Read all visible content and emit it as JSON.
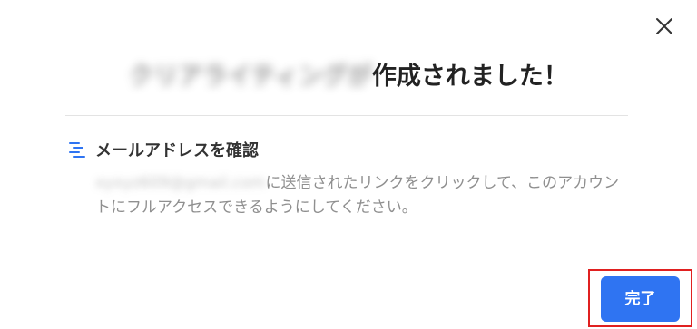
{
  "dialog": {
    "title_blurred_prefix": "クリアライティングが",
    "title": "作成されました！",
    "section_heading": "メールアドレスを確認",
    "email_blurred": "xyxyz609@gmail.com",
    "description": "に送信されたリンクをクリックして、このアカウントにフルアクセスできるようにしてください。",
    "done_label": "完了"
  },
  "icons": {
    "close": "close-icon",
    "verify": "list-lines-icon"
  },
  "colors": {
    "primary_button": "#2f74f2",
    "highlight_border": "#e02020",
    "icon_accent": "#2f74f2"
  }
}
